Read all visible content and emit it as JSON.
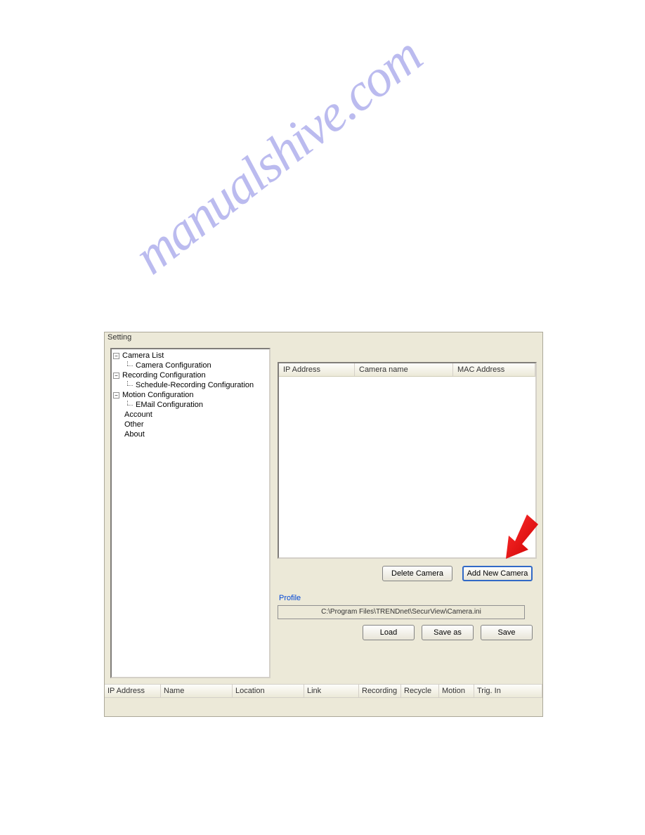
{
  "panel": {
    "title": "Setting"
  },
  "tree": {
    "items": [
      {
        "label": "Camera List",
        "hasToggle": true,
        "level": 0
      },
      {
        "label": "Camera Configuration",
        "hasToggle": false,
        "level": 1
      },
      {
        "label": "Recording Configuration",
        "hasToggle": true,
        "level": 0
      },
      {
        "label": "Schedule-Recording Configuration",
        "hasToggle": false,
        "level": 1
      },
      {
        "label": "Motion Configuration",
        "hasToggle": true,
        "level": 0
      },
      {
        "label": "EMail Configuration",
        "hasToggle": false,
        "level": 1
      },
      {
        "label": "Account",
        "hasToggle": false,
        "level": 0
      },
      {
        "label": "Other",
        "hasToggle": false,
        "level": 0
      },
      {
        "label": "About",
        "hasToggle": false,
        "level": 0
      }
    ],
    "toggleSymbol": "−"
  },
  "cameraTable": {
    "headers": {
      "ip": "IP Address",
      "name": "Camera name",
      "mac": "MAC Address"
    }
  },
  "buttons": {
    "deleteCamera": "Delete Camera",
    "addNewCamera": "Add New Camera",
    "load": "Load",
    "saveAs": "Save as",
    "save": "Save"
  },
  "profile": {
    "label": "Profile",
    "path": "C:\\Program Files\\TRENDnet\\SecurView\\Camera.ini"
  },
  "statusTable": {
    "headers": {
      "ip": "IP Address",
      "name": "Name",
      "location": "Location",
      "link": "Link",
      "recording": "Recording",
      "recycle": "Recycle",
      "motion": "Motion",
      "trigin": "Trig. In"
    }
  },
  "watermark": "manualshive.com"
}
